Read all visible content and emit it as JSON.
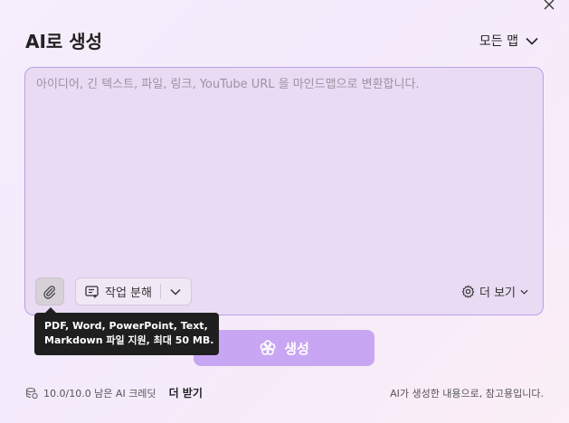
{
  "dialog": {
    "title": "AI로 생성",
    "close_icon": "close-icon"
  },
  "mode_select": {
    "label": "모든 맵",
    "icon": "chevron-down-icon"
  },
  "input": {
    "placeholder": "아이디어, 긴 텍스트, 파일, 링크, YouTube URL 을 마인드맵으로 변환합니다.",
    "value": ""
  },
  "toolbar": {
    "attach_icon": "paperclip-icon",
    "decompose_label": "작업 분해",
    "decompose_icon": "task-list-icon",
    "more_label": "더 보기",
    "more_icon": "gear-icon"
  },
  "tooltip": {
    "line1": "PDF, Word, PowerPoint, Text,",
    "line2": "Markdown 파일 지원, 최대 50 MB."
  },
  "generate": {
    "label": "생성",
    "icon": "flower-icon"
  },
  "footer": {
    "credits": "10.0/10.0 남은 AI 크레딧",
    "get_more": "더 받기",
    "disclaimer": "AI가 생성한 내용으로, 참고용입니다."
  },
  "colors": {
    "accent": "#c9a6f3",
    "border": "#b9a0e6"
  }
}
